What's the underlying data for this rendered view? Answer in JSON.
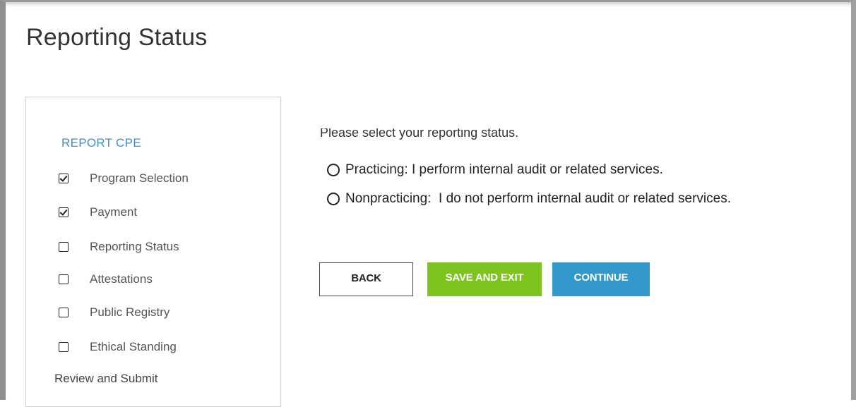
{
  "page": {
    "title": "Reporting Status"
  },
  "sidebar": {
    "heading": "REPORT CPE",
    "steps": [
      {
        "label": "Program Selection",
        "checked": true
      },
      {
        "label": "Payment",
        "checked": true
      },
      {
        "label": "Reporting Status",
        "checked": false
      },
      {
        "label": "Attestations",
        "checked": false
      },
      {
        "label": "Public Registry",
        "checked": false
      },
      {
        "label": "Ethical Standing",
        "checked": false
      }
    ],
    "review_label": "Review and Submit"
  },
  "form": {
    "prompt": "Please select your reporting status.",
    "options": [
      {
        "label": "Practicing: I perform internal audit or related services.",
        "selected": false
      },
      {
        "label": "Nonpracticing:  I do not perform internal audit or related services.",
        "selected": false
      }
    ]
  },
  "buttons": {
    "back": "BACK",
    "save_exit": "SAVE AND EXIT",
    "continue": "CONTINUE"
  },
  "colors": {
    "accent_link": "#3f8fc2",
    "save_button": "#7dc41e",
    "continue_button": "#3399cc"
  }
}
